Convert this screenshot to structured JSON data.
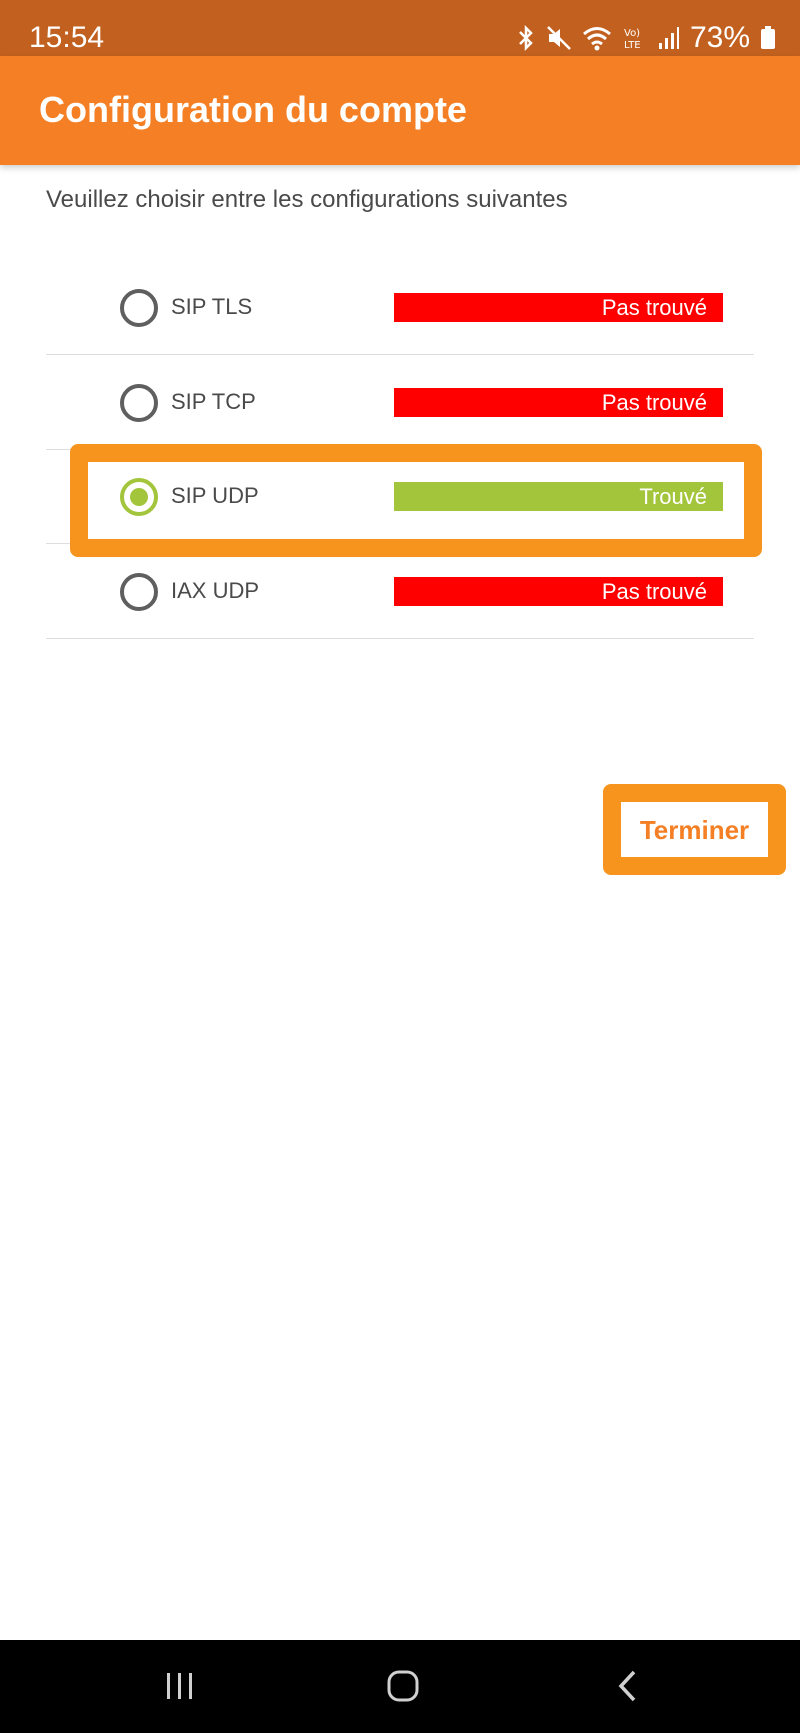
{
  "status_bar": {
    "time": "15:54",
    "battery": "73%",
    "icons": [
      "bluetooth-icon",
      "mute-icon",
      "wifi-icon",
      "volte-icon",
      "signal-icon",
      "battery-icon"
    ]
  },
  "app_bar": {
    "title": "Configuration du compte"
  },
  "instruction": "Veuillez choisir entre les configurations suivantes",
  "options": [
    {
      "label": "SIP TLS",
      "status": "Pas trouvé",
      "status_color": "#ff0000",
      "selected": false
    },
    {
      "label": "SIP TCP",
      "status": "Pas trouvé",
      "status_color": "#ff0000",
      "selected": false
    },
    {
      "label": "SIP UDP",
      "status": "Trouvé",
      "status_color": "#a3c53c",
      "selected": true
    },
    {
      "label": "IAX UDP",
      "status": "Pas trouvé",
      "status_color": "#ff0000",
      "selected": false
    }
  ],
  "finish_button": {
    "label": "Terminer"
  },
  "colors": {
    "accent": "#f47f24",
    "highlight": "#f7941d",
    "found": "#a3c53c",
    "not_found": "#ff0000"
  },
  "nav_bar": {
    "buttons": [
      "recents-icon",
      "home-icon",
      "back-icon"
    ]
  }
}
